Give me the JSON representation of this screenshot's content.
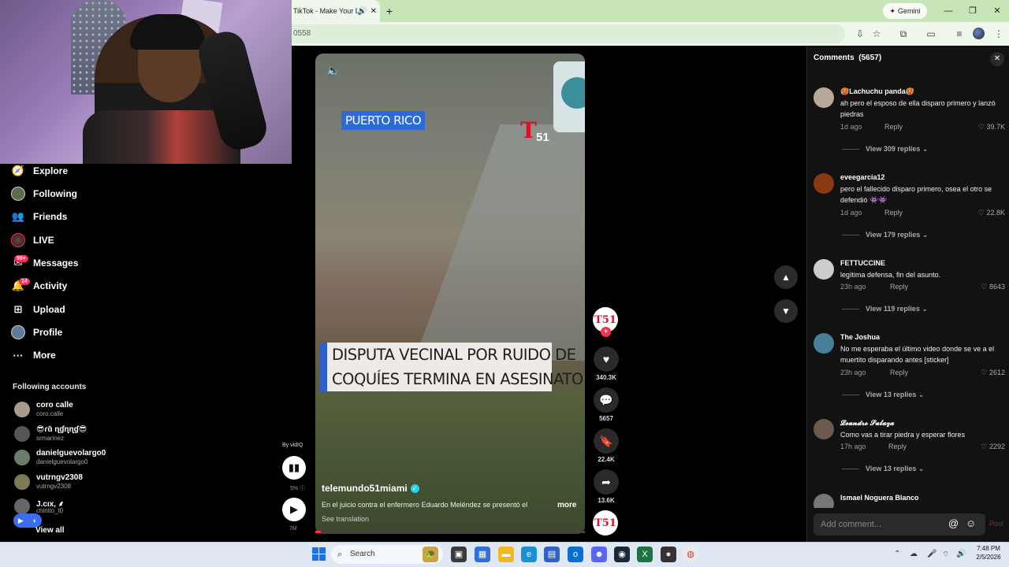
{
  "browser": {
    "tab_title": "TikTok - Make Your Da",
    "address": "0558",
    "gemini_label": "Gemini"
  },
  "sidebar": {
    "items": [
      {
        "label": "Explore",
        "icon": "compass-icon"
      },
      {
        "label": "Following",
        "icon": "avatar"
      },
      {
        "label": "Friends",
        "icon": "friends-icon"
      },
      {
        "label": "LIVE",
        "icon": "live-avatar"
      },
      {
        "label": "Messages",
        "icon": "messages-icon",
        "badge": "99+"
      },
      {
        "label": "Activity",
        "icon": "activity-icon",
        "badge": "14"
      },
      {
        "label": "Upload",
        "icon": "upload-icon"
      },
      {
        "label": "Profile",
        "icon": "profile-avatar"
      },
      {
        "label": "More",
        "icon": "ellipsis-icon"
      }
    ],
    "following_title": "Following accounts",
    "accounts": [
      {
        "name": "coro calle",
        "handle": "coro.calle"
      },
      {
        "name": "😎ɾɑ̃ ɳɠɳɳɠ😎",
        "handle": "srmarinez"
      },
      {
        "name": "danielguevolargo0",
        "handle": "danielguevolargo0"
      },
      {
        "name": "vutrngv2308",
        "handle": "vutrngv2308"
      },
      {
        "name": "J.cıx, ⸙",
        "handle": "chinito_t0"
      }
    ],
    "view_all": "View all"
  },
  "vidiq": {
    "by_label": "By vidIQ",
    "percent": "5%",
    "views": "7M"
  },
  "video": {
    "location_label": "PUERTO RICO",
    "logo_text": "51",
    "headline_line1": "DISPUTA VECINAL POR RUIDO DE",
    "headline_line2": "COQUÍES TERMINA EN ASESINATO",
    "author": "telemundo51miami",
    "caption": "En el juicio contra el enfermero Eduardo Meléndez se presentó el",
    "more": "more",
    "see_translation": "See translation",
    "progress": 0.02
  },
  "actions": {
    "likes": "340.3K",
    "comments": "5657",
    "saves": "22.4K",
    "shares": "13.6K"
  },
  "comments": {
    "title": "Comments",
    "count": "(5657)",
    "items": [
      {
        "user": "🥵Lachuchu panda🥵",
        "text": "ah pero el esposo de ella disparo primero y lanzó piedras",
        "time": "1d ago",
        "likes": "39.7K",
        "replies": "View 309 replies"
      },
      {
        "user": "eveegarcia12",
        "text": "pero el fallecido disparo primero, osea el otro se defendió 👾👾",
        "time": "1d ago",
        "likes": "22.8K",
        "replies": "View 179 replies"
      },
      {
        "user": "FETTUCCINE",
        "text": "legítima defensa, fin del asunto.",
        "time": "23h ago",
        "likes": "8643",
        "replies": "View 119 replies"
      },
      {
        "user": "The Joshua",
        "text": "No me esperaba el último video donde se ve a el muertito disparando antes [sticker]",
        "time": "23h ago",
        "likes": "2612",
        "replies": "View 13 replies"
      },
      {
        "user": "𝓛𝓮𝓪𝓷𝓭𝓻𝓸 𝓢𝓪𝓵𝓪𝔃𝓪",
        "text": "Como vas a tirar piedra y esperar flores",
        "time": "17h ago",
        "likes": "2292",
        "replies": "View 13 replies"
      },
      {
        "user": "Ismael Noguera Blanco",
        "text": "",
        "time": "",
        "likes": "",
        "replies": ""
      }
    ],
    "reply_label": "Reply",
    "add_placeholder": "Add comment...",
    "post_label": "Post"
  },
  "taskbar": {
    "search_label": "Search",
    "time": "7:48 PM",
    "date": "2/5/2026"
  }
}
